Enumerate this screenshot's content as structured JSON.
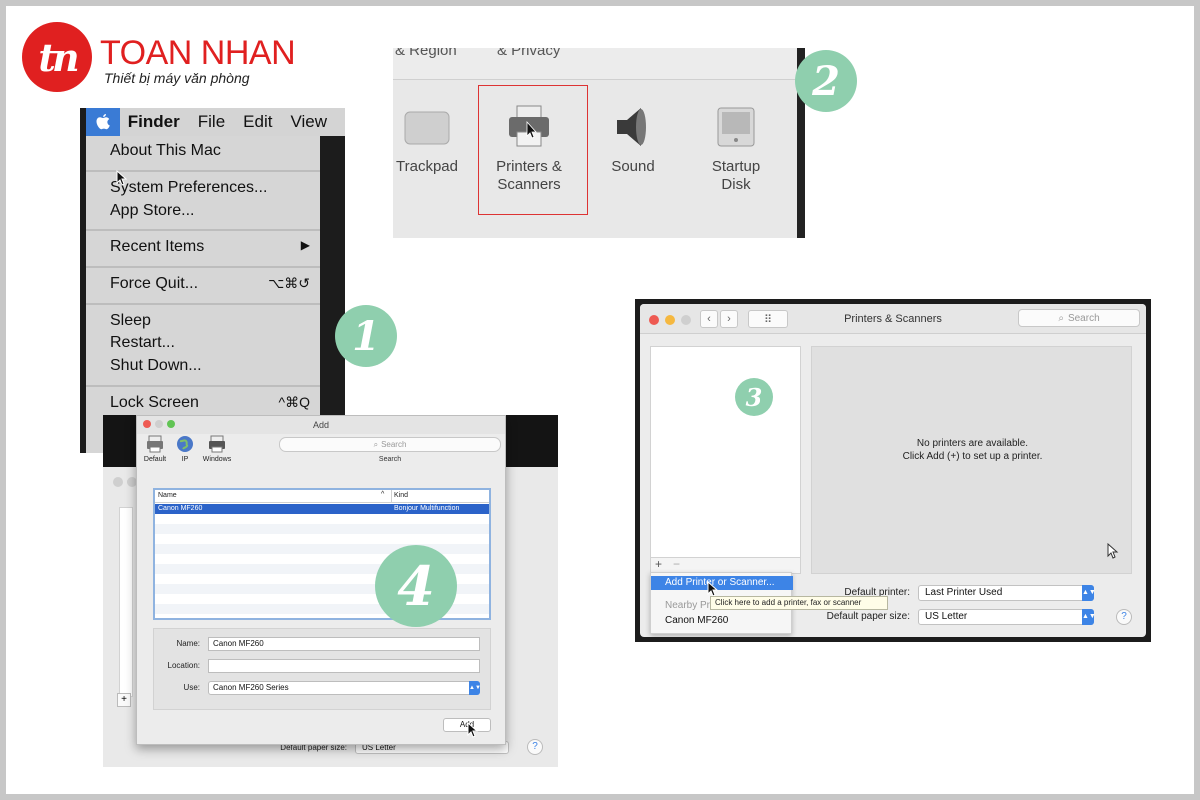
{
  "brand": {
    "logo_mark": "tn",
    "name": "TOAN NHAN",
    "tagline": "Thiết bị máy văn phòng",
    "color": "#e02020"
  },
  "badges": [
    "1",
    "2",
    "3",
    "4"
  ],
  "badge_color": "#8fcfae",
  "step1": {
    "menubar": {
      "apple_icon": "apple-icon",
      "items": [
        "Finder",
        "File",
        "Edit",
        "View"
      ]
    },
    "menu": {
      "about": "About This Mac",
      "system_prefs": "System Preferences...",
      "app_store": "App Store...",
      "recent_items": "Recent Items",
      "recent_items_arrow": "▶",
      "force_quit": "Force Quit...",
      "force_quit_shortcut": "⌥⌘↺",
      "sleep": "Sleep",
      "restart": "Restart...",
      "shut_down": "Shut Down...",
      "lock_screen": "Lock Screen",
      "lock_screen_shortcut": "^⌘Q"
    }
  },
  "step2": {
    "top_labels": [
      "& Region",
      "& Privacy"
    ],
    "prefs": [
      {
        "label": "Trackpad",
        "icon": "trackpad-icon"
      },
      {
        "label": "Printers &\nScanners",
        "icon": "printer-icon"
      },
      {
        "label": "Sound",
        "icon": "speaker-icon"
      },
      {
        "label": "Startup\nDisk",
        "icon": "disk-icon"
      }
    ]
  },
  "step3": {
    "window_title": "Printers & Scanners",
    "search_placeholder": "Search",
    "no_printers_line1": "No printers are available.",
    "no_printers_line2": "Click Add (+) to set up a printer.",
    "add_symbol": "+",
    "remove_symbol": "−",
    "default_printer_label": "Default printer:",
    "default_printer_value": "Last Printer Used",
    "paper_size_label": "Default paper size:",
    "paper_size_value": "US Letter",
    "help": "?",
    "dropdown": {
      "selected": "Add Printer or Scanner...",
      "section": "Nearby Pri",
      "item": "Canon MF260"
    },
    "tooltip": "Click here to add a printer, fax or scanner"
  },
  "step4": {
    "dialog_title": "Add",
    "toolbar": [
      {
        "label": "Default",
        "icon": "default-printer-icon"
      },
      {
        "label": "IP",
        "icon": "globe-icon"
      },
      {
        "label": "Windows",
        "icon": "windows-printer-icon"
      }
    ],
    "search_placeholder": "Search",
    "search_caption": "Search",
    "columns": {
      "name": "Name",
      "kind": "Kind"
    },
    "rows": [
      {
        "name": "Canon MF260",
        "kind": "Bonjour Multifunction"
      }
    ],
    "form": {
      "name_label": "Name:",
      "name_value": "Canon MF260",
      "location_label": "Location:",
      "location_value": "",
      "use_label": "Use:",
      "use_value": "Canon MF260 Series"
    },
    "add_button": "Add",
    "background_paper_label": "Default paper size:",
    "background_paper_value": "US Letter",
    "background_help": "?",
    "background_add": "+"
  }
}
